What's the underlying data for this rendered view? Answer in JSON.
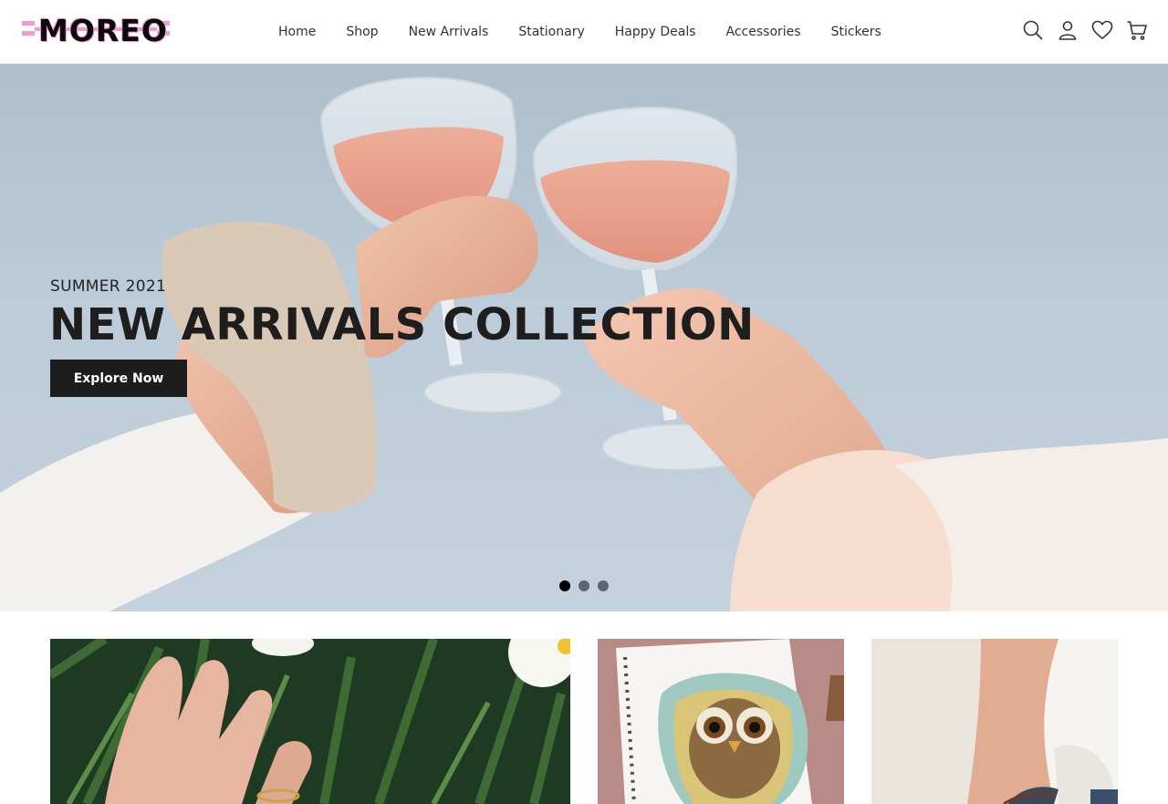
{
  "header": {
    "logo_text": "MOREO",
    "nav": [
      {
        "label": "Home"
      },
      {
        "label": "Shop"
      },
      {
        "label": "New Arrivals"
      },
      {
        "label": "Stationary"
      },
      {
        "label": "Happy Deals"
      },
      {
        "label": "Accessories"
      },
      {
        "label": "Stickers"
      }
    ],
    "icons": [
      "search-icon",
      "user-icon",
      "heart-icon",
      "cart-icon"
    ]
  },
  "hero": {
    "eyebrow": "SUMMER 2021",
    "title": "NEW ARRIVALS COLLECTION",
    "cta_label": "Explore Now",
    "slides_total": 3,
    "active_slide": 1
  },
  "colors": {
    "text_dark": "#1e1e1e",
    "button_bg": "#1d1d1d",
    "logo_accent": "#f29ad2",
    "sky": "#bcccd8"
  }
}
